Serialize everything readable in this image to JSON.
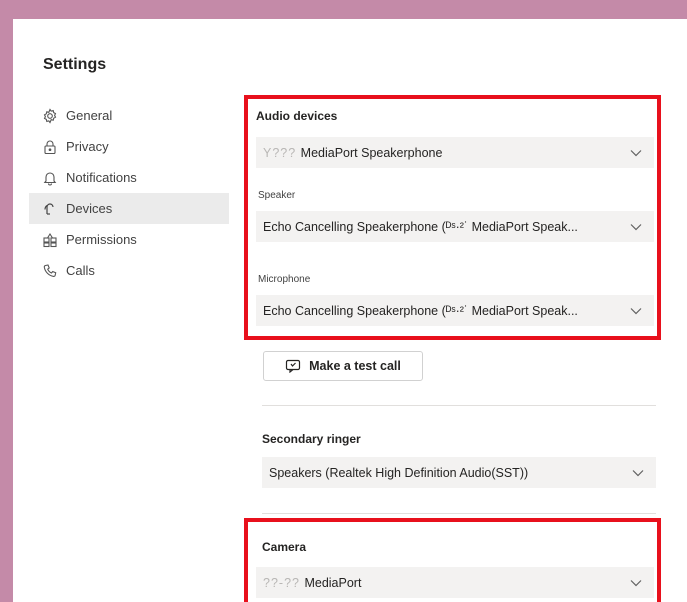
{
  "settings": {
    "title": "Settings"
  },
  "nav": {
    "items": [
      {
        "label": "General",
        "icon": "gear-icon"
      },
      {
        "label": "Privacy",
        "icon": "lock-icon"
      },
      {
        "label": "Notifications",
        "icon": "bell-icon"
      },
      {
        "label": "Devices",
        "icon": "device-icon",
        "active": true
      },
      {
        "label": "Permissions",
        "icon": "permissions-icon"
      },
      {
        "label": "Calls",
        "icon": "phone-icon"
      }
    ]
  },
  "audio": {
    "heading": "Audio devices",
    "device_redacted": "Y??? ",
    "device_value": "MediaPort Speakerphone",
    "speaker_label": "Speaker",
    "speaker_value": "Echo Cancelling Speakerphone (ᴰˢ·²˙ MediaPort Speak...",
    "mic_label": "Microphone",
    "mic_value": "Echo Cancelling Speakerphone (ᴰˢ·²˙ MediaPort Speak..."
  },
  "test_call": {
    "label": "Make a test call"
  },
  "secondary_ringer": {
    "heading": "Secondary ringer",
    "value": "Speakers (Realtek High Definition Audio(SST))"
  },
  "camera": {
    "heading": "Camera",
    "redacted": "??-?? ",
    "value": "MediaPort"
  },
  "colors": {
    "highlight": "#e8101c",
    "background": "#c48aa8",
    "nav_active": "#ebebeb"
  }
}
